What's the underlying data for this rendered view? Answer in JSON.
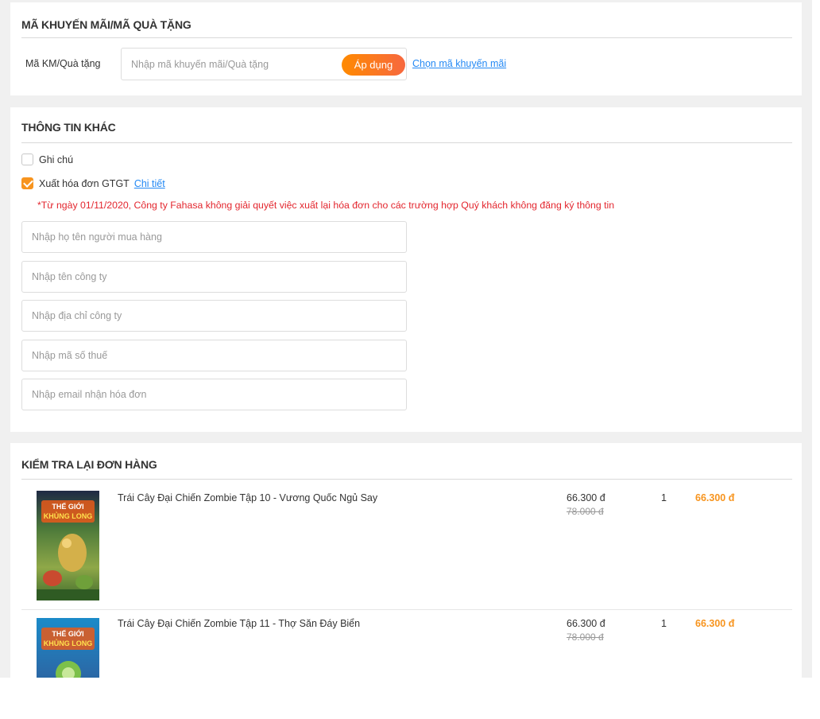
{
  "promo": {
    "title": "MÃ KHUYẾN MÃI/MÃ QUÀ TẶNG",
    "label": "Mã KM/Quà tặng",
    "placeholder": "Nhập mã khuyến mãi/Quà tặng",
    "apply_label": "Áp dụng",
    "choose_link": "Chọn mã khuyến mãi"
  },
  "other": {
    "title": "THÔNG TIN KHÁC",
    "note_label": "Ghi chú",
    "note_checked": false,
    "invoice_label": "Xuất hóa đơn GTGT",
    "invoice_checked": true,
    "detail_link": "Chi tiết",
    "notice": "*Từ ngày 01/11/2020, Công ty Fahasa không giải quyết việc xuất lại hóa đơn cho các trường hợp Quý khách không đăng ký thông tin",
    "fields": [
      {
        "placeholder": "Nhập họ tên người mua hàng"
      },
      {
        "placeholder": "Nhập tên công ty"
      },
      {
        "placeholder": "Nhập địa chỉ công ty"
      },
      {
        "placeholder": "Nhập mã số thuế"
      },
      {
        "placeholder": "Nhập email nhận hóa đơn"
      }
    ]
  },
  "order": {
    "title": "KIỂM TRA LẠI ĐƠN HÀNG",
    "items": [
      {
        "name": "Trái Cây Đại Chiến Zombie Tập 10 - Vương Quốc Ngủ Say",
        "price": "66.300 đ",
        "old_price": "78.000 đ",
        "qty": "1",
        "total": "66.300 đ",
        "cover_text_1": "THẾ GIỚI",
        "cover_text_2": "KHỦNG LONG"
      },
      {
        "name": "Trái Cây Đại Chiến Zombie Tập 11 - Thợ Săn Đáy Biển",
        "price": "66.300 đ",
        "old_price": "78.000 đ",
        "qty": "1",
        "total": "66.300 đ",
        "cover_text_1": "THẾ GIỚI",
        "cover_text_2": "KHỦNG LONG"
      }
    ]
  },
  "colors": {
    "accent": "#f7941e",
    "link": "#2489f4",
    "notice": "#e3262e",
    "background": "#f0f0f0"
  }
}
